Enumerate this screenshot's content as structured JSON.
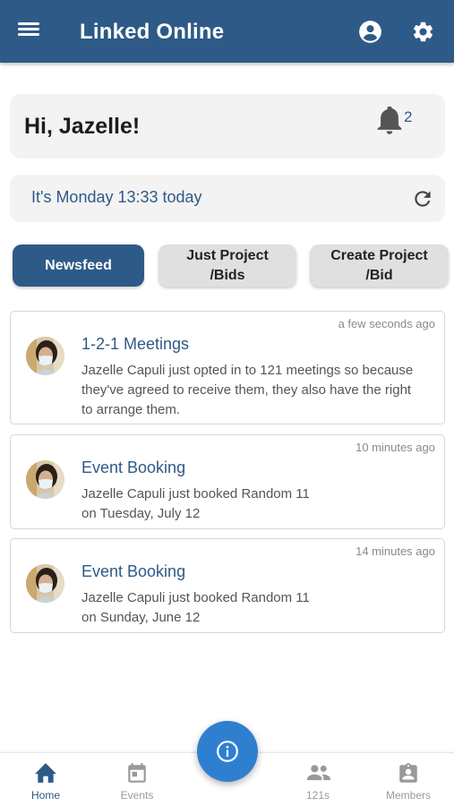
{
  "appbar": {
    "title": "Linked Online",
    "icons": [
      "menu-icon",
      "account-circle-icon",
      "gear-icon"
    ]
  },
  "greeting": {
    "text": "Hi, Jazelle!",
    "notification_count": "2",
    "icon": "bell-icon"
  },
  "date_banner": {
    "text": "It's Monday 13:33 today",
    "icon": "refresh-icon"
  },
  "tabs": [
    {
      "label": "Newsfeed",
      "active": true
    },
    {
      "label": "Just Project\n/Bids",
      "line1": "Just Project",
      "line2": "/Bids",
      "active": false
    },
    {
      "label": "Create Project\n/Bid",
      "line1": "Create Project",
      "line2": "/Bid",
      "active": false
    }
  ],
  "feed": [
    {
      "time": "a few seconds ago",
      "title": "1-2-1 Meetings",
      "description": "Jazelle Capuli just opted in to 121 meetings so because they've agreed to receive them, they also have the right to arrange them."
    },
    {
      "time": "10 minutes ago",
      "title": "Event Booking",
      "description": "Jazelle Capuli just booked Random 11 on Tuesday, July 12"
    },
    {
      "time": "14 minutes ago",
      "title": "Event Booking",
      "description": "Jazelle Capuli just booked Random 11 on Sunday, June 12"
    }
  ],
  "bottom_nav": {
    "items": [
      {
        "label": "Home",
        "icon": "home-icon",
        "active": true
      },
      {
        "label": "Events",
        "icon": "calendar-icon",
        "active": false
      },
      {
        "label": "121s",
        "icon": "people-icon",
        "active": false
      },
      {
        "label": "Members",
        "icon": "contact-card-icon",
        "active": false
      }
    ],
    "fab_icon": "info-icon"
  },
  "colors": {
    "primary": "#2e5a87",
    "fab": "#2f7fd1",
    "card_bg": "#f3f3f3",
    "tab_inactive": "#e0e0e0"
  }
}
